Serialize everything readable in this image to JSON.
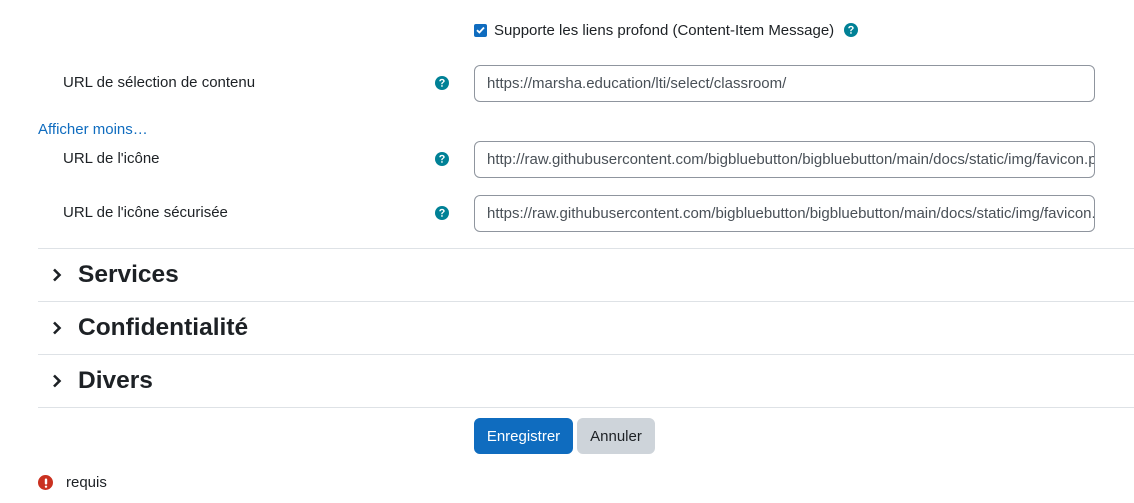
{
  "deep_linking": {
    "label": "Supporte les liens profond (Content-Item Message)",
    "checked": true
  },
  "fields": [
    {
      "label": "URL de sélection de contenu",
      "value": "https://marsha.education/lti/select/classroom/"
    },
    {
      "label": "URL de l'icône",
      "value": "http://raw.githubusercontent.com/bigbluebutton/bigbluebutton/main/docs/static/img/favicon.png"
    },
    {
      "label": "URL de l'icône sécurisée",
      "value": "https://raw.githubusercontent.com/bigbluebutton/bigbluebutton/main/docs/static/img/favicon.png"
    }
  ],
  "show_less_link": "Afficher moins…",
  "sections": [
    {
      "title": "Services"
    },
    {
      "title": "Confidentialité"
    },
    {
      "title": "Divers"
    }
  ],
  "buttons": {
    "save": "Enregistrer",
    "cancel": "Annuler"
  },
  "required_legend": "requis",
  "colors": {
    "primary": "#0f6cbf",
    "help_icon": "#008196",
    "required_icon": "#ca3120"
  },
  "icons": {
    "help": "question-circle-icon",
    "section_toggle": "chevron-right-icon",
    "required": "exclamation-circle-icon",
    "checkbox": "checkmark-icon"
  }
}
